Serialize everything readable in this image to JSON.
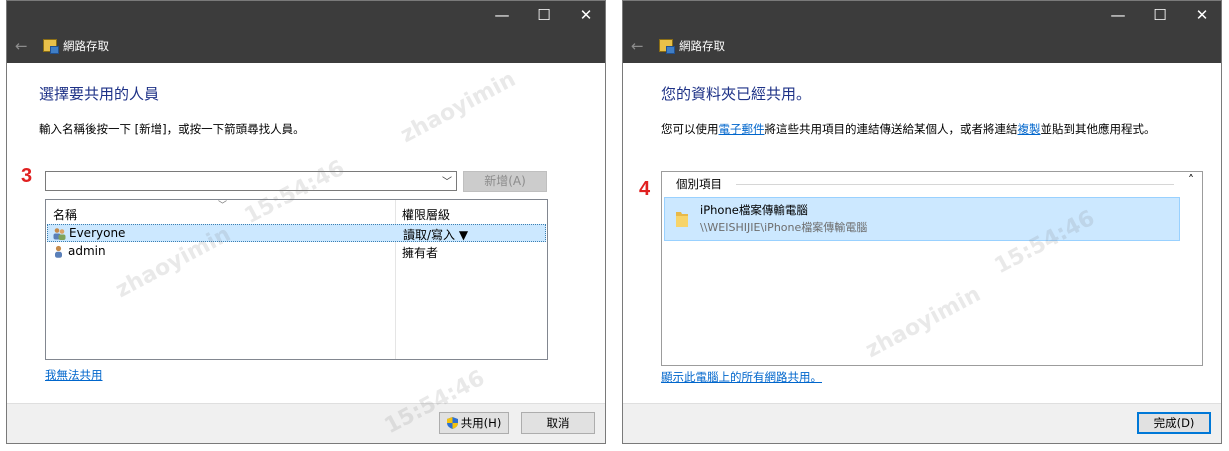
{
  "left_window": {
    "app_title": "網路存取",
    "heading": "選擇要共用的人員",
    "instruction": "輸入名稱後按一下 [新增]，或按一下箭頭尋找人員。",
    "step_number": "3",
    "name_input_value": "",
    "add_button_label": "新增(A)",
    "columns": {
      "name": "名稱",
      "permission": "權限層級"
    },
    "rows": [
      {
        "name": "Everyone",
        "permission": "讀取/寫入 ▼",
        "selected": true,
        "icon": "group-users-icon"
      },
      {
        "name": "admin",
        "permission": "擁有者",
        "selected": false,
        "icon": "user-icon"
      }
    ],
    "cant_share_link": "我無法共用",
    "share_button_label": "共用(H)",
    "cancel_button_label": "取消"
  },
  "right_window": {
    "app_title": "網路存取",
    "heading": "您的資料夾已經共用。",
    "desc_prefix": "您可以使用",
    "desc_email_link": "電子郵件",
    "desc_middle": "將這些共用項目的連結傳送給某個人，或者將連結",
    "desc_copy_link": "複製",
    "desc_suffix": "並貼到其他應用程式。",
    "step_number": "4",
    "group_title": "個別項目",
    "item_name": "iPhone檔案傳輸電腦",
    "item_path": "\\\\WEISHIJIE\\iPhone檔案傳輸電腦",
    "show_all_link": "顯示此電腦上的所有網路共用。",
    "done_button_label": "完成(D)"
  },
  "watermark": {
    "name": "zhaoyimin",
    "time": "15:54:46"
  },
  "colors": {
    "titlebar": "#3c3c3c",
    "heading": "#1e3287",
    "link": "#0066cc",
    "selection": "#cce8ff",
    "step": "#e02020"
  }
}
